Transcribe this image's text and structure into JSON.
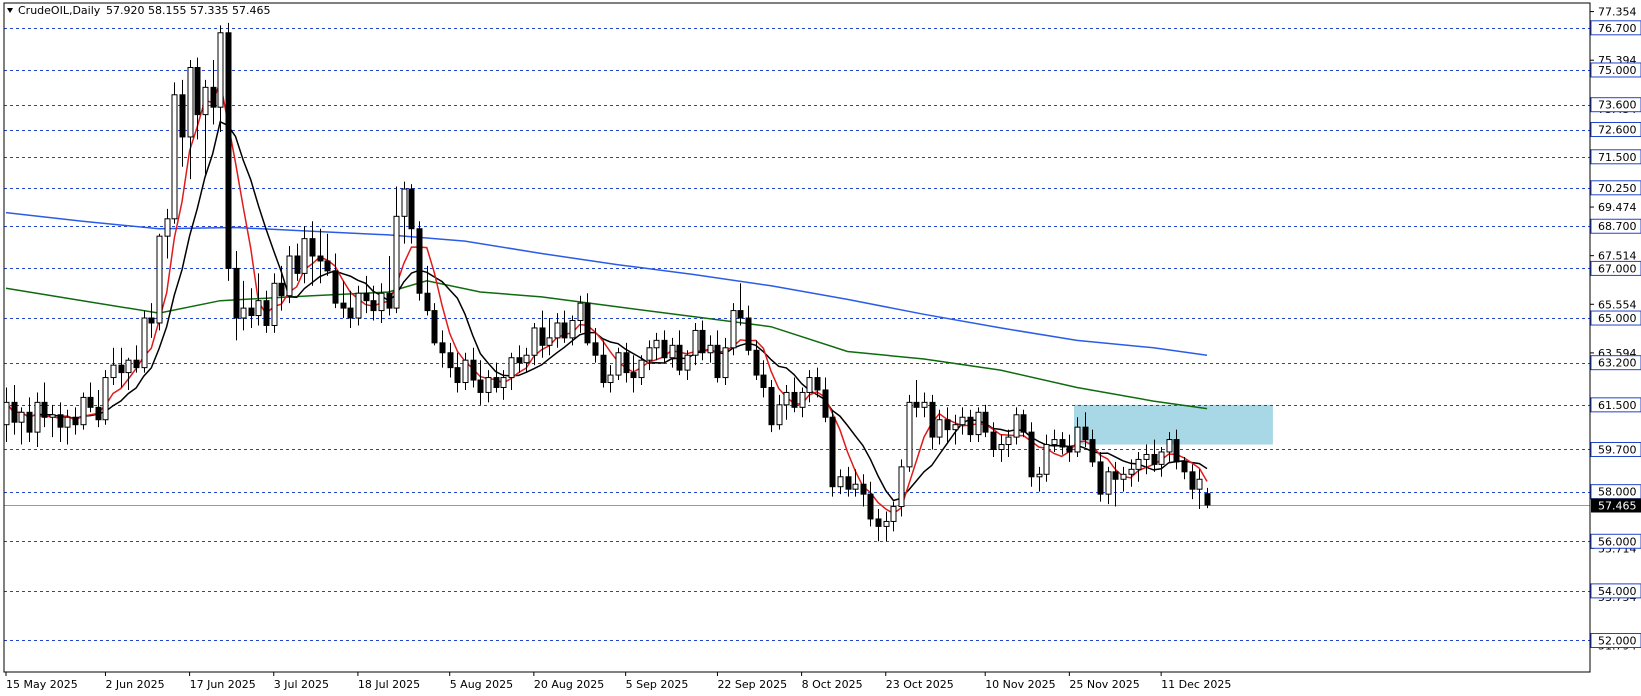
{
  "chart_data": {
    "type": "candlestick",
    "title": "CrudeOIL,Daily",
    "ohlc_summary": "57.920 58.155 57.335 57.465",
    "current_price": 57.465,
    "ylim": [
      50.73,
      77.7
    ],
    "price_axis_ticks": [
      "77.354",
      "75.394",
      "73.434",
      "71.474",
      "69.474",
      "67.514",
      "65.554",
      "63.594",
      "61.634",
      "59.674",
      "57.714",
      "55.714",
      "53.754",
      "51.794"
    ],
    "horizontal_levels": [
      {
        "value": 76.7,
        "label": "76.700"
      },
      {
        "value": 75.0,
        "label": "75.000"
      },
      {
        "value": 73.6,
        "label": "73.600"
      },
      {
        "value": 72.6,
        "label": "72.600"
      },
      {
        "value": 71.5,
        "label": "71.500"
      },
      {
        "value": 70.25,
        "label": "70.250"
      },
      {
        "value": 68.7,
        "label": "68.700"
      },
      {
        "value": 67.0,
        "label": "67.000"
      },
      {
        "value": 65.0,
        "label": "65.000"
      },
      {
        "value": 63.2,
        "label": "63.200"
      },
      {
        "value": 61.5,
        "label": "61.500"
      },
      {
        "value": 59.7,
        "label": "59.700"
      },
      {
        "value": 58.0,
        "label": "58.000"
      },
      {
        "value": 56.0,
        "label": "56.000"
      },
      {
        "value": 54.0,
        "label": "54.000"
      },
      {
        "value": 52.0,
        "label": "52.000"
      }
    ],
    "x_tick_labels": [
      "15 May 2025",
      "2 Jun 2025",
      "17 Jun 2025",
      "3 Jul 2025",
      "18 Jul 2025",
      "5 Aug 2025",
      "20 Aug 2025",
      "5 Sep 2025",
      "22 Sep 2025",
      "8 Oct 2025",
      "23 Oct 2025",
      "10 Nov 2025",
      "25 Nov 2025",
      "11 Dec 2025"
    ],
    "x_tick_index": [
      0,
      13,
      24,
      35,
      46,
      58,
      69,
      81,
      93,
      104,
      115,
      128,
      139,
      151
    ],
    "candles": [
      [
        60.7,
        62.2,
        60.0,
        61.6
      ],
      [
        61.6,
        62.3,
        60.3,
        60.8
      ],
      [
        60.8,
        61.4,
        59.9,
        61.2
      ],
      [
        61.2,
        61.8,
        60.0,
        60.4
      ],
      [
        60.4,
        62.0,
        59.8,
        61.6
      ],
      [
        61.6,
        62.4,
        60.6,
        61.0
      ],
      [
        61.0,
        61.5,
        60.2,
        61.1
      ],
      [
        61.1,
        61.6,
        60.0,
        60.6
      ],
      [
        60.6,
        61.3,
        59.9,
        61.0
      ],
      [
        61.0,
        61.4,
        60.3,
        60.7
      ],
      [
        60.7,
        62.0,
        60.5,
        61.8
      ],
      [
        61.8,
        62.4,
        61.2,
        61.4
      ],
      [
        61.4,
        62.1,
        60.6,
        60.9
      ],
      [
        60.9,
        62.9,
        60.7,
        62.6
      ],
      [
        62.6,
        63.8,
        62.3,
        63.1
      ],
      [
        63.1,
        63.8,
        62.2,
        62.8
      ],
      [
        62.8,
        63.4,
        62.1,
        63.3
      ],
      [
        63.3,
        63.9,
        62.8,
        63.0
      ],
      [
        63.0,
        65.3,
        62.8,
        65.0
      ],
      [
        65.0,
        65.6,
        64.2,
        64.8
      ],
      [
        64.8,
        68.4,
        64.5,
        68.3
      ],
      [
        68.3,
        69.4,
        67.4,
        69.0
      ],
      [
        69.0,
        74.5,
        68.8,
        74.0
      ],
      [
        74.0,
        74.6,
        71.1,
        72.3
      ],
      [
        72.3,
        75.4,
        70.6,
        75.1
      ],
      [
        75.1,
        75.5,
        72.2,
        73.2
      ],
      [
        73.2,
        74.6,
        70.8,
        74.3
      ],
      [
        74.3,
        75.4,
        72.8,
        73.5
      ],
      [
        73.5,
        76.8,
        72.5,
        76.5
      ],
      [
        76.5,
        76.9,
        66.5,
        67.0
      ],
      [
        67.0,
        67.7,
        64.1,
        65.0
      ],
      [
        65.0,
        66.5,
        64.5,
        65.4
      ],
      [
        65.4,
        66.2,
        64.6,
        65.1
      ],
      [
        65.1,
        66.8,
        64.7,
        65.7
      ],
      [
        65.7,
        66.1,
        64.4,
        64.7
      ],
      [
        64.7,
        66.8,
        64.4,
        66.4
      ],
      [
        66.4,
        67.1,
        65.3,
        65.9
      ],
      [
        65.9,
        67.9,
        65.6,
        67.5
      ],
      [
        67.5,
        68.0,
        66.5,
        66.8
      ],
      [
        66.8,
        68.7,
        66.4,
        68.2
      ],
      [
        68.2,
        68.9,
        66.3,
        67.5
      ],
      [
        67.5,
        68.6,
        66.4,
        67.3
      ],
      [
        67.3,
        68.4,
        66.7,
        66.9
      ],
      [
        66.9,
        67.6,
        65.4,
        65.6
      ],
      [
        65.6,
        66.5,
        65.0,
        65.4
      ],
      [
        65.4,
        66.1,
        64.6,
        65.0
      ],
      [
        65.0,
        66.3,
        64.7,
        66.0
      ],
      [
        66.0,
        66.7,
        65.2,
        65.7
      ],
      [
        65.7,
        66.3,
        64.9,
        65.3
      ],
      [
        65.3,
        66.4,
        64.8,
        66.0
      ],
      [
        66.0,
        67.5,
        65.1,
        65.4
      ],
      [
        65.4,
        70.3,
        65.2,
        69.1
      ],
      [
        69.1,
        70.5,
        68.0,
        70.2
      ],
      [
        70.2,
        70.4,
        68.0,
        68.6
      ],
      [
        68.6,
        68.9,
        65.7,
        66.0
      ],
      [
        66.0,
        67.1,
        65.1,
        65.3
      ],
      [
        65.3,
        65.6,
        63.9,
        64.0
      ],
      [
        64.0,
        64.5,
        63.0,
        63.6
      ],
      [
        63.6,
        64.0,
        62.6,
        63.0
      ],
      [
        63.0,
        63.6,
        62.0,
        62.4
      ],
      [
        62.4,
        63.6,
        62.1,
        63.3
      ],
      [
        63.3,
        63.8,
        62.2,
        62.5
      ],
      [
        62.5,
        63.3,
        61.5,
        62.0
      ],
      [
        62.0,
        62.9,
        61.6,
        62.6
      ],
      [
        62.6,
        63.2,
        62.0,
        62.2
      ],
      [
        62.2,
        62.9,
        61.7,
        62.6
      ],
      [
        62.6,
        63.6,
        62.1,
        63.4
      ],
      [
        63.4,
        63.9,
        62.8,
        63.2
      ],
      [
        63.2,
        63.8,
        62.8,
        63.5
      ],
      [
        63.5,
        64.8,
        63.1,
        64.6
      ],
      [
        64.6,
        65.3,
        63.4,
        63.9
      ],
      [
        63.9,
        65.0,
        63.5,
        64.2
      ],
      [
        64.2,
        65.2,
        63.8,
        64.8
      ],
      [
        64.8,
        65.3,
        64.0,
        64.2
      ],
      [
        64.2,
        65.1,
        63.9,
        64.9
      ],
      [
        64.9,
        65.9,
        64.4,
        65.6
      ],
      [
        65.6,
        66.0,
        63.9,
        64.0
      ],
      [
        64.0,
        64.6,
        63.2,
        63.5
      ],
      [
        63.5,
        64.1,
        62.2,
        62.4
      ],
      [
        62.4,
        63.1,
        62.0,
        62.7
      ],
      [
        62.7,
        63.8,
        62.5,
        63.6
      ],
      [
        63.6,
        64.0,
        62.4,
        62.8
      ],
      [
        62.8,
        63.5,
        62.0,
        62.6
      ],
      [
        62.6,
        63.5,
        62.3,
        63.3
      ],
      [
        63.3,
        64.1,
        62.9,
        63.8
      ],
      [
        63.8,
        64.4,
        63.3,
        64.1
      ],
      [
        64.1,
        64.5,
        63.2,
        63.4
      ],
      [
        63.4,
        64.2,
        63.0,
        63.9
      ],
      [
        63.9,
        64.5,
        62.7,
        62.9
      ],
      [
        62.9,
        63.7,
        62.5,
        63.5
      ],
      [
        63.5,
        64.8,
        63.1,
        64.5
      ],
      [
        64.5,
        64.9,
        63.3,
        63.6
      ],
      [
        63.6,
        64.3,
        63.2,
        63.9
      ],
      [
        63.9,
        64.5,
        62.4,
        62.6
      ],
      [
        62.6,
        64.2,
        62.3,
        63.8
      ],
      [
        63.8,
        65.6,
        63.5,
        65.3
      ],
      [
        65.3,
        66.4,
        64.7,
        65.0
      ],
      [
        65.0,
        65.5,
        63.5,
        63.7
      ],
      [
        63.7,
        64.1,
        62.5,
        62.7
      ],
      [
        62.7,
        63.3,
        61.8,
        62.2
      ],
      [
        62.2,
        62.5,
        60.4,
        60.7
      ],
      [
        60.7,
        61.9,
        60.5,
        61.5
      ],
      [
        61.5,
        62.3,
        60.9,
        62.0
      ],
      [
        62.0,
        62.6,
        61.2,
        61.4
      ],
      [
        61.4,
        62.2,
        61.0,
        62.0
      ],
      [
        62.0,
        62.9,
        61.6,
        62.6
      ],
      [
        62.6,
        63.0,
        61.8,
        62.1
      ],
      [
        62.1,
        62.6,
        60.8,
        61.0
      ],
      [
        61.0,
        61.3,
        57.8,
        58.2
      ],
      [
        58.2,
        58.9,
        57.9,
        58.6
      ],
      [
        58.6,
        59.0,
        57.8,
        58.1
      ],
      [
        58.1,
        58.9,
        57.8,
        58.3
      ],
      [
        58.3,
        58.7,
        57.4,
        57.9
      ],
      [
        57.9,
        58.4,
        56.6,
        56.9
      ],
      [
        56.9,
        57.3,
        56.0,
        56.6
      ],
      [
        56.6,
        57.2,
        56.0,
        56.8
      ],
      [
        56.8,
        57.6,
        56.4,
        57.4
      ],
      [
        57.4,
        59.3,
        57.0,
        59.0
      ],
      [
        59.0,
        61.9,
        58.8,
        61.6
      ],
      [
        61.6,
        62.5,
        61.0,
        61.4
      ],
      [
        61.4,
        62.0,
        61.0,
        61.6
      ],
      [
        61.6,
        61.9,
        59.7,
        60.2
      ],
      [
        60.2,
        61.3,
        59.9,
        60.9
      ],
      [
        60.9,
        61.4,
        60.0,
        60.5
      ],
      [
        60.5,
        61.1,
        59.9,
        60.7
      ],
      [
        60.7,
        61.4,
        60.3,
        61.0
      ],
      [
        61.0,
        61.3,
        60.0,
        60.3
      ],
      [
        60.3,
        61.4,
        60.0,
        61.2
      ],
      [
        61.2,
        61.5,
        60.2,
        60.4
      ],
      [
        60.4,
        60.8,
        59.4,
        59.7
      ],
      [
        59.7,
        60.3,
        59.2,
        59.9
      ],
      [
        59.9,
        60.5,
        59.4,
        60.2
      ],
      [
        60.2,
        61.4,
        59.9,
        61.1
      ],
      [
        61.1,
        61.3,
        60.2,
        60.4
      ],
      [
        60.4,
        60.8,
        58.2,
        58.6
      ],
      [
        58.6,
        59.0,
        58.0,
        58.7
      ],
      [
        58.7,
        60.3,
        58.4,
        59.9
      ],
      [
        59.9,
        60.5,
        59.6,
        60.1
      ],
      [
        60.1,
        60.4,
        59.5,
        59.8
      ],
      [
        59.8,
        60.3,
        59.2,
        59.6
      ],
      [
        59.6,
        61.0,
        59.4,
        60.6
      ],
      [
        60.6,
        61.2,
        59.8,
        60.1
      ],
      [
        60.1,
        60.5,
        59.0,
        59.2
      ],
      [
        59.2,
        59.6,
        57.6,
        57.9
      ],
      [
        57.9,
        59.0,
        57.5,
        58.8
      ],
      [
        58.8,
        59.2,
        57.4,
        58.5
      ],
      [
        58.5,
        59.0,
        58.0,
        58.7
      ],
      [
        58.7,
        59.3,
        58.2,
        58.9
      ],
      [
        58.9,
        59.6,
        58.4,
        59.3
      ],
      [
        59.3,
        59.9,
        58.7,
        59.5
      ],
      [
        59.5,
        60.1,
        58.8,
        59.1
      ],
      [
        59.1,
        59.8,
        58.6,
        59.6
      ],
      [
        59.6,
        60.4,
        59.2,
        60.1
      ],
      [
        60.1,
        60.5,
        58.9,
        59.2
      ],
      [
        59.2,
        59.4,
        58.5,
        58.8
      ],
      [
        58.8,
        59.1,
        57.7,
        58.1
      ],
      [
        58.1,
        58.9,
        57.3,
        58.5
      ],
      [
        57.92,
        58.155,
        57.335,
        57.465
      ]
    ],
    "moving_averages": [
      {
        "color": "#2b5ce6",
        "points": [
          [
            0,
            69.25
          ],
          [
            10,
            68.9
          ],
          [
            20,
            68.6
          ],
          [
            30,
            68.65
          ],
          [
            40,
            68.5
          ],
          [
            50,
            68.35
          ],
          [
            60,
            68.1
          ],
          [
            70,
            67.6
          ],
          [
            80,
            67.15
          ],
          [
            90,
            66.75
          ],
          [
            100,
            66.3
          ],
          [
            110,
            65.75
          ],
          [
            120,
            65.15
          ],
          [
            130,
            64.6
          ],
          [
            140,
            64.1
          ],
          [
            150,
            63.8
          ],
          [
            157,
            63.5
          ]
        ]
      },
      {
        "color": "#0f6b0f",
        "points": [
          [
            0,
            66.2
          ],
          [
            10,
            65.7
          ],
          [
            20,
            65.2
          ],
          [
            28,
            65.7
          ],
          [
            40,
            65.9
          ],
          [
            50,
            66.05
          ],
          [
            55,
            66.5
          ],
          [
            62,
            66.05
          ],
          [
            70,
            65.85
          ],
          [
            80,
            65.45
          ],
          [
            90,
            65.05
          ],
          [
            100,
            64.65
          ],
          [
            110,
            63.65
          ],
          [
            120,
            63.35
          ],
          [
            130,
            62.9
          ],
          [
            140,
            62.2
          ],
          [
            150,
            61.65
          ],
          [
            157,
            61.35
          ]
        ]
      }
    ],
    "blue_zone": {
      "from_index": 140,
      "to_index": 166,
      "low": 59.9,
      "high": 61.5,
      "color": "#a8d8e6"
    },
    "ma_colors": {
      "fast": "#e01b1b",
      "slow": "#000000"
    },
    "colors": {
      "grid": "#2244cc",
      "candle": "#000000",
      "candle_up_fill": "#ffffff",
      "candle_down_fill": "#000000",
      "price_tag_bg": "#000000",
      "price_tag_text": "#ffffff"
    }
  }
}
